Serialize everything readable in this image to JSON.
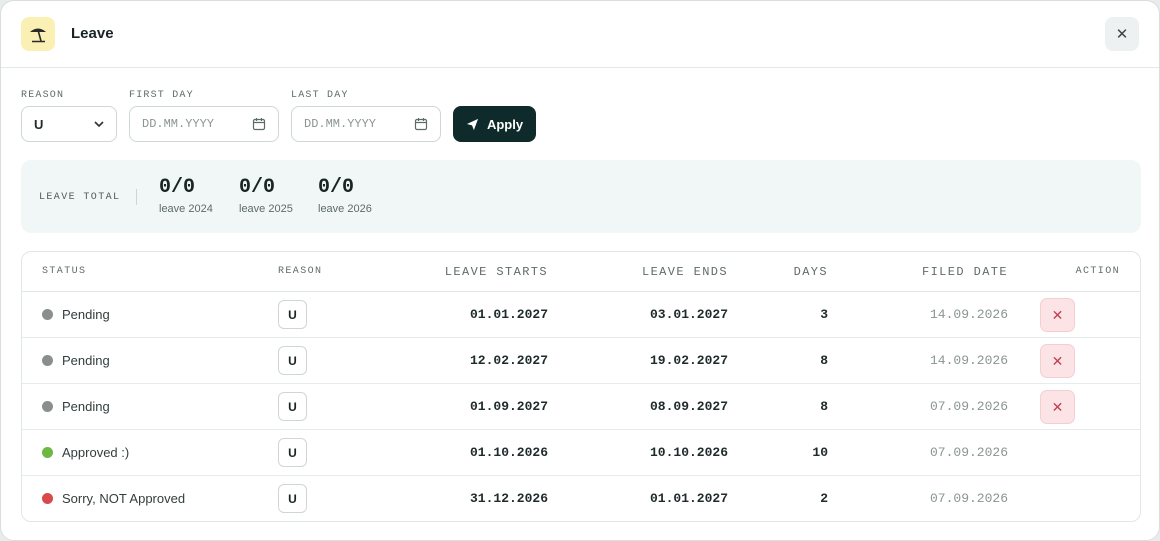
{
  "header": {
    "title": "Leave",
    "app_icon": "beach-umbrella-icon",
    "close_icon": "close-icon",
    "close_glyph": "✕"
  },
  "form": {
    "reason": {
      "label": "REASON",
      "value": "U"
    },
    "first_day": {
      "label": "FIRST DAY",
      "placeholder": "DD.MM.YYYY"
    },
    "last_day": {
      "label": "LAST DAY",
      "placeholder": "DD.MM.YYYY"
    },
    "apply_label": "Apply"
  },
  "summary": {
    "label": "LEAVE TOTAL",
    "stats": [
      {
        "value": "0/0",
        "caption": "leave 2024"
      },
      {
        "value": "0/0",
        "caption": "leave 2025"
      },
      {
        "value": "0/0",
        "caption": "leave 2026"
      }
    ]
  },
  "table": {
    "columns": {
      "status": "STATUS",
      "reason": "REASON",
      "leave_starts": "LEAVE STARTS",
      "leave_ends": "LEAVE ENDS",
      "days": "DAYS",
      "filed_date": "FILED DATE",
      "action": "ACTION"
    },
    "cancel_glyph": "✕",
    "rows": [
      {
        "status": "Pending",
        "status_color": "#8a8f8e",
        "reason": "U",
        "starts": "01.01.2027",
        "ends": "03.01.2027",
        "days": "3",
        "filed": "14.09.2026",
        "cancellable": true
      },
      {
        "status": "Pending",
        "status_color": "#8a8f8e",
        "reason": "U",
        "starts": "12.02.2027",
        "ends": "19.02.2027",
        "days": "8",
        "filed": "14.09.2026",
        "cancellable": true
      },
      {
        "status": "Pending",
        "status_color": "#8a8f8e",
        "reason": "U",
        "starts": "01.09.2027",
        "ends": "08.09.2027",
        "days": "8",
        "filed": "07.09.2026",
        "cancellable": true
      },
      {
        "status": "Approved :)",
        "status_color": "#6cb843",
        "reason": "U",
        "starts": "01.10.2026",
        "ends": "10.10.2026",
        "days": "10",
        "filed": "07.09.2026",
        "cancellable": false
      },
      {
        "status": "Sorry, NOT Approved",
        "status_color": "#d84a4a",
        "reason": "U",
        "starts": "31.12.2026",
        "ends": "01.01.2027",
        "days": "2",
        "filed": "07.09.2026",
        "cancellable": false
      }
    ]
  },
  "colors": {
    "primary": "#0f2a2a",
    "summary_bg": "#f1f7f6",
    "danger_bg": "#fbe3e6",
    "icon_bg": "#fbf0b4"
  }
}
